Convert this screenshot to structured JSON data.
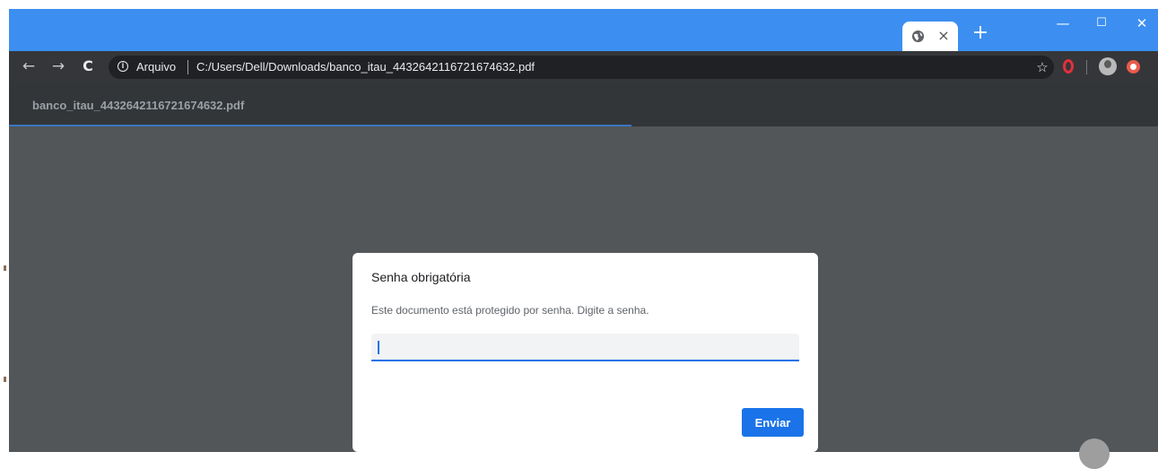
{
  "browser": {
    "tab": {
      "icon": "globe-icon",
      "close_symbol": "×"
    },
    "new_tab_symbol": "+",
    "window_controls": {
      "minimize": "—",
      "maximize": "☐",
      "close": "✕"
    },
    "toolbar": {
      "back_symbol": "←",
      "forward_symbol": "→",
      "reload_symbol": "C",
      "scheme_label": "Arquivo",
      "url": "C:/Users/Dell/Downloads/banco_itau_4432642116721674632.pdf",
      "bookmark_symbol": "☆",
      "extensions": [
        "opera-icon",
        "avatar",
        "extension-icon"
      ]
    }
  },
  "pdf_viewer": {
    "title": "banco_itau_4432642116721674632.pdf"
  },
  "dialog": {
    "title": "Senha obrigatória",
    "message": "Este documento está protegido por senha. Digite a senha.",
    "input_value": "",
    "submit_label": "Enviar"
  },
  "colors": {
    "tab_strip": "#3c8ff0",
    "toolbar": "#35363a",
    "viewer_bg": "#525659",
    "accent": "#1a73e8"
  }
}
